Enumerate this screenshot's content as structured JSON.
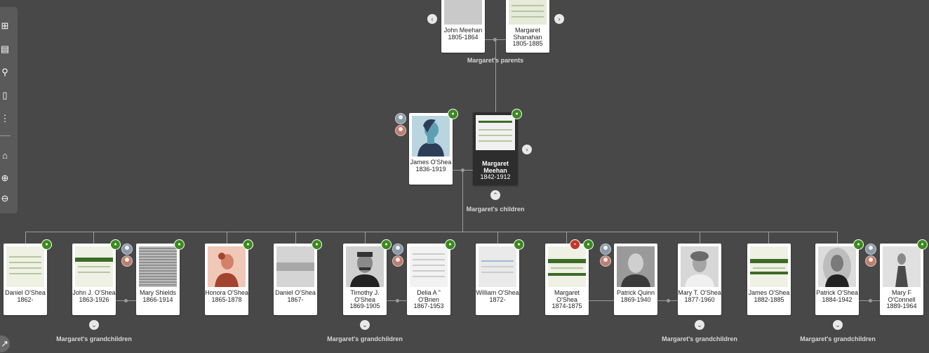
{
  "toolbar": {
    "icons": [
      "tree-view-icon",
      "pedigree-icon",
      "find-person-icon",
      "bookmark-icon",
      "more-icon",
      "home-icon",
      "zoom-in-icon",
      "zoom-out-icon"
    ]
  },
  "parents": {
    "label": "Margaret's parents",
    "father": {
      "name": "John Meehan",
      "dates": "1805-1864"
    },
    "mother": {
      "name": "Margaret Shanahan",
      "dates": "1805-1885"
    }
  },
  "couple": {
    "spouse": {
      "name": "James O'Shea",
      "dates": "1836-1919"
    },
    "focus": {
      "name": "Margaret Meehan",
      "dates": "1842-1912"
    },
    "children_label": "Margaret's children"
  },
  "children": [
    {
      "name": "Daniel O'Shea",
      "dates": "1862-"
    },
    {
      "name": "John J. O'Shea",
      "dates": "1863-1926"
    },
    {
      "name": "Mary Shields",
      "dates": "1866-1914"
    },
    {
      "name": "Honora O'Shea",
      "dates": "1865-1878"
    },
    {
      "name": "Daniel O'Shea",
      "dates": "1867-"
    },
    {
      "name": "Timothy J. O'Shea",
      "dates": "1869-1905"
    },
    {
      "name": "Delia A \" O'Brien",
      "dates": "1867-1953"
    },
    {
      "name": "William O'Shea",
      "dates": "1872-"
    },
    {
      "name": "Margaret O'Shea",
      "dates": "1874-1875"
    },
    {
      "name": "Patrick Quinn",
      "dates": "1869-1940"
    },
    {
      "name": "Mary T. O'Shea",
      "dates": "1877-1960"
    },
    {
      "name": "James O'Shea",
      "dates": "1882-1885"
    },
    {
      "name": "Patrick O'Shea",
      "dates": "1884-1942"
    },
    {
      "name": "Mary F O'Connell",
      "dates": "1889-1964"
    }
  ],
  "grandchildren_label": "Margaret's grandchildren",
  "colors": {
    "background": "#484848",
    "badge_green": "#3c8a1f",
    "badge_red": "#c0392b",
    "focus_card": "#2d2d2d"
  }
}
